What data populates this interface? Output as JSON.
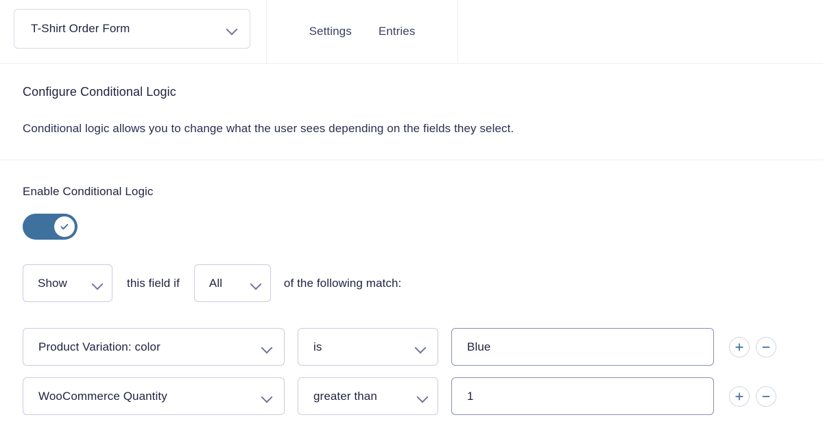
{
  "topbar": {
    "form_selector": {
      "value": "T-Shirt Order Form",
      "icon": "chevron-down-icon"
    },
    "tabs": [
      {
        "label": "Settings"
      },
      {
        "label": "Entries"
      }
    ]
  },
  "intro": {
    "title": "Configure Conditional Logic",
    "description": "Conditional logic allows you to change what the user sees depending on the fields they select."
  },
  "enable": {
    "label": "Enable Conditional Logic",
    "toggle_state": "on",
    "toggle_icon": "check-icon"
  },
  "rule_header": {
    "action": "Show",
    "text_middle": "this field if",
    "match_type": "All",
    "text_end": "of the following match:"
  },
  "conditions": [
    {
      "field": "Product Variation: color",
      "operator": "is",
      "value": "Blue",
      "add_label": "+",
      "remove_label": "−"
    },
    {
      "field": "WooCommerce Quantity",
      "operator": "greater than",
      "value": "1",
      "add_label": "+",
      "remove_label": "−"
    }
  ],
  "colors": {
    "toggle_on": "#3f719e",
    "accent": "#3f719e",
    "text": "#1f2240",
    "border_light": "#d9dae6",
    "border_input": "#8a8fb5",
    "divider": "#eceef4"
  }
}
